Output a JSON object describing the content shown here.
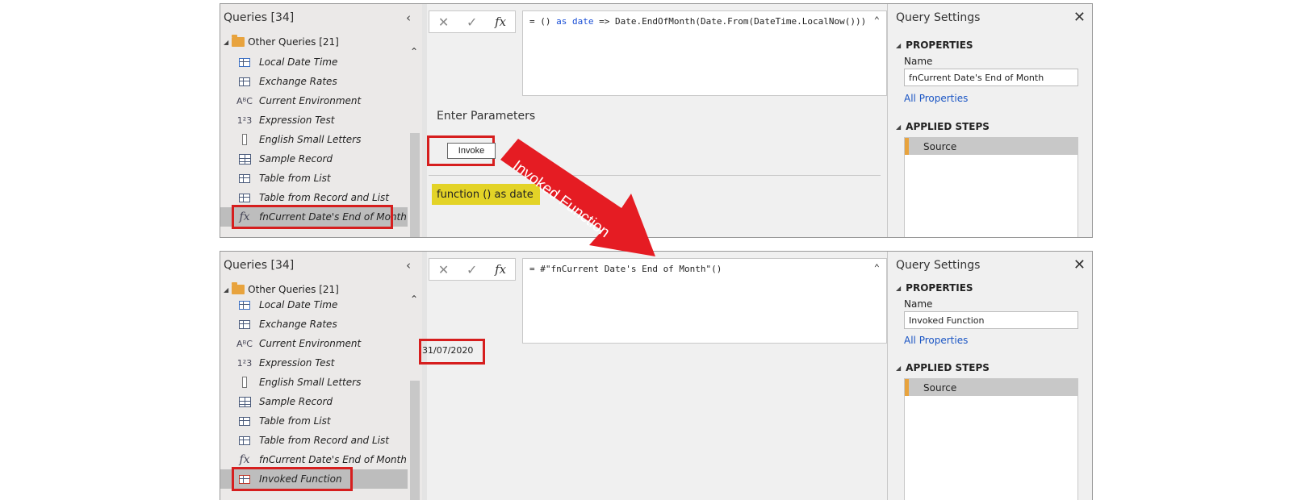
{
  "panels": [
    {
      "queries_title": "Queries [34]",
      "group_label": "Other Queries [21]",
      "items": [
        {
          "label": "Local Date Time",
          "icon": "datetime-icon",
          "glyph": "🕒"
        },
        {
          "label": "Exchange Rates",
          "icon": "table-icon"
        },
        {
          "label": "Current Environment",
          "icon": "text-type-icon",
          "glyph": "AᴮC"
        },
        {
          "label": "Expression Test",
          "icon": "number-type-icon",
          "glyph": "1²3"
        },
        {
          "label": "English Small Letters",
          "icon": "list-icon"
        },
        {
          "label": "Sample Record",
          "icon": "record-icon"
        },
        {
          "label": "Table from List",
          "icon": "table-icon"
        },
        {
          "label": "Table from Record and List",
          "icon": "table-icon"
        },
        {
          "label": "fnCurrent Date's End of Month",
          "icon": "function-icon",
          "glyph": "fx",
          "selected": true
        }
      ],
      "formula_prefix": "= () ",
      "formula_kw1": "as",
      "formula_mid": " ",
      "formula_kw2": "date",
      "formula_rest": " => Date.EndOfMonth(Date.From(DateTime.LocalNow()))",
      "enter_parameters": "Enter Parameters",
      "invoke_label": "Invoke",
      "function_sig": "function () as date",
      "settings_title": "Query Settings",
      "properties_label": "PROPERTIES",
      "name_label": "Name",
      "name_value": "fnCurrent Date's End of Month",
      "all_properties": "All Properties",
      "applied_steps_label": "APPLIED STEPS",
      "step": "Source"
    },
    {
      "queries_title": "Queries [34]",
      "group_label": "Other Queries [21]",
      "items": [
        {
          "label": "Local Date Time",
          "icon": "datetime-icon",
          "glyph": "🕒"
        },
        {
          "label": "Exchange Rates",
          "icon": "table-icon"
        },
        {
          "label": "Current Environment",
          "icon": "text-type-icon",
          "glyph": "AᴮC"
        },
        {
          "label": "Expression Test",
          "icon": "number-type-icon",
          "glyph": "1²3"
        },
        {
          "label": "English Small Letters",
          "icon": "list-icon"
        },
        {
          "label": "Sample Record",
          "icon": "record-icon"
        },
        {
          "label": "Table from List",
          "icon": "table-icon"
        },
        {
          "label": "Table from Record and List",
          "icon": "table-icon"
        },
        {
          "label": "fnCurrent Date's End of Month",
          "icon": "function-icon",
          "glyph": "fx"
        },
        {
          "label": "Invoked Function",
          "icon": "invoked-table-icon",
          "selected": true
        }
      ],
      "formula_prefix": "= #\"fnCurrent Date's End of Month\"()",
      "result_value": "31/07/2020",
      "settings_title": "Query Settings",
      "properties_label": "PROPERTIES",
      "name_label": "Name",
      "name_value": "Invoked Function",
      "all_properties": "All Properties",
      "applied_steps_label": "APPLIED STEPS",
      "step": "Source"
    }
  ],
  "annotation": {
    "arrow_label": "Invoked Function",
    "arrow_color": "#e51c23",
    "highlight_color": "#d61e1e"
  }
}
